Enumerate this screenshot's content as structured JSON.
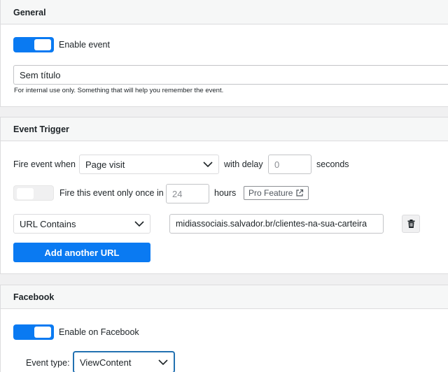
{
  "general": {
    "title": "General",
    "enable_label": "Enable event",
    "enabled": true,
    "name_value": "Sem título",
    "help_text": "For internal use only. Something that will help you remember the event."
  },
  "trigger": {
    "title": "Event Trigger",
    "fire_when_label": "Fire event when",
    "fire_when_value": "Page visit",
    "with_delay_label": "with delay",
    "delay_placeholder": "0",
    "seconds_label": "seconds",
    "once_enabled": false,
    "once_label": "Fire this event only once in",
    "hours_value": "24",
    "hours_label": "hours",
    "pro_label": "Pro Feature",
    "url_condition_value": "URL Contains",
    "url_value": "midiassociais.salvador.br/clientes-na-sua-carteira",
    "add_url_label": "Add another URL"
  },
  "facebook": {
    "title": "Facebook",
    "enabled": true,
    "enable_label": "Enable on Facebook",
    "event_type_label": "Event type:",
    "event_type_value": "ViewContent"
  },
  "colors": {
    "accent": "#0a7af2",
    "focus_border": "#2271b1"
  },
  "icons": [
    "chevron-down-icon",
    "external-link-icon",
    "trash-icon"
  ]
}
